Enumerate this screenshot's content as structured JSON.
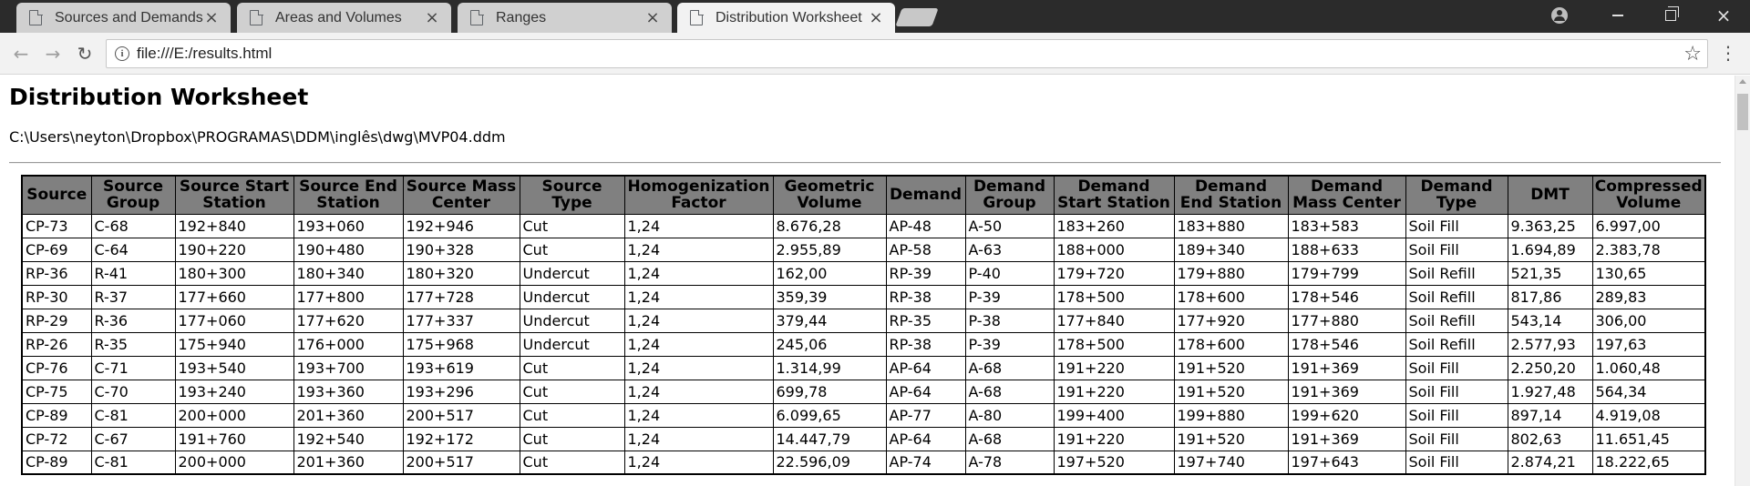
{
  "browser": {
    "tabs": [
      {
        "title": "Sources and Demands",
        "active": false
      },
      {
        "title": "Areas and Volumes",
        "active": false
      },
      {
        "title": "Ranges",
        "active": false
      },
      {
        "title": "Distribution Worksheet",
        "active": true
      }
    ],
    "url": "file:///E:/results.html",
    "icons": [
      "document-icon",
      "close-icon",
      "profile-icon",
      "minimize-icon",
      "maximize-icon",
      "close-window-icon",
      "back-icon",
      "forward-icon",
      "reload-icon",
      "info-icon",
      "star-icon",
      "menu-icon"
    ],
    "close_glyph": "×",
    "star_glyph": "☆",
    "menu_glyph": "⋮"
  },
  "page": {
    "title": "Distribution Worksheet",
    "file_path": "C:\\Users\\neyton\\Dropbox\\PROGRAMAS\\DDM\\inglês\\dwg\\MVP04.ddm"
  },
  "table": {
    "headers": [
      "Source",
      "Source Group",
      "Source Start Station",
      "Source End Station",
      "Source Mass Center",
      "Source Type",
      "Homogenization Factor",
      "Geometric Volume",
      "Demand",
      "Demand Group",
      "Demand Start Station",
      "Demand End Station",
      "Demand Mass Center",
      "Demand Type",
      "DMT",
      "Compressed Volume"
    ],
    "rows": [
      [
        "CP-73",
        "C-68",
        "192+840",
        "193+060",
        "192+946",
        "Cut",
        "1,24",
        "8.676,28",
        "AP-48",
        "A-50",
        "183+260",
        "183+880",
        "183+583",
        "Soil Fill",
        "9.363,25",
        "6.997,00"
      ],
      [
        "CP-69",
        "C-64",
        "190+220",
        "190+480",
        "190+328",
        "Cut",
        "1,24",
        "2.955,89",
        "AP-58",
        "A-63",
        "188+000",
        "189+340",
        "188+633",
        "Soil Fill",
        "1.694,89",
        "2.383,78"
      ],
      [
        "RP-36",
        "R-41",
        "180+300",
        "180+340",
        "180+320",
        "Undercut",
        "1,24",
        "162,00",
        "RP-39",
        "P-40",
        "179+720",
        "179+880",
        "179+799",
        "Soil Refill",
        "521,35",
        "130,65"
      ],
      [
        "RP-30",
        "R-37",
        "177+660",
        "177+800",
        "177+728",
        "Undercut",
        "1,24",
        "359,39",
        "RP-38",
        "P-39",
        "178+500",
        "178+600",
        "178+546",
        "Soil Refill",
        "817,86",
        "289,83"
      ],
      [
        "RP-29",
        "R-36",
        "177+060",
        "177+620",
        "177+337",
        "Undercut",
        "1,24",
        "379,44",
        "RP-35",
        "P-38",
        "177+840",
        "177+920",
        "177+880",
        "Soil Refill",
        "543,14",
        "306,00"
      ],
      [
        "RP-26",
        "R-35",
        "175+940",
        "176+000",
        "175+968",
        "Undercut",
        "1,24",
        "245,06",
        "RP-38",
        "P-39",
        "178+500",
        "178+600",
        "178+546",
        "Soil Refill",
        "2.577,93",
        "197,63"
      ],
      [
        "CP-76",
        "C-71",
        "193+540",
        "193+700",
        "193+619",
        "Cut",
        "1,24",
        "1.314,99",
        "AP-64",
        "A-68",
        "191+220",
        "191+520",
        "191+369",
        "Soil Fill",
        "2.250,20",
        "1.060,48"
      ],
      [
        "CP-75",
        "C-70",
        "193+240",
        "193+360",
        "193+296",
        "Cut",
        "1,24",
        "699,78",
        "AP-64",
        "A-68",
        "191+220",
        "191+520",
        "191+369",
        "Soil Fill",
        "1.927,48",
        "564,34"
      ],
      [
        "CP-89",
        "C-81",
        "200+000",
        "201+360",
        "200+517",
        "Cut",
        "1,24",
        "6.099,65",
        "AP-77",
        "A-80",
        "199+400",
        "199+880",
        "199+620",
        "Soil Fill",
        "897,14",
        "4.919,08"
      ],
      [
        "CP-72",
        "C-67",
        "191+760",
        "192+540",
        "192+172",
        "Cut",
        "1,24",
        "14.447,79",
        "AP-64",
        "A-68",
        "191+220",
        "191+520",
        "191+369",
        "Soil Fill",
        "802,63",
        "11.651,45"
      ],
      [
        "CP-89",
        "C-81",
        "200+000",
        "201+360",
        "200+517",
        "Cut",
        "1,24",
        "22.596,09",
        "AP-74",
        "A-78",
        "197+520",
        "197+740",
        "197+643",
        "Soil Fill",
        "2.874,21",
        "18.222,65"
      ]
    ]
  },
  "colors": {
    "header_bg": "#808080",
    "tabstrip_bg": "#2b2b2b",
    "active_tab_bg": "#f2f2f2",
    "inactive_tab_bg": "#d0d0d0"
  }
}
